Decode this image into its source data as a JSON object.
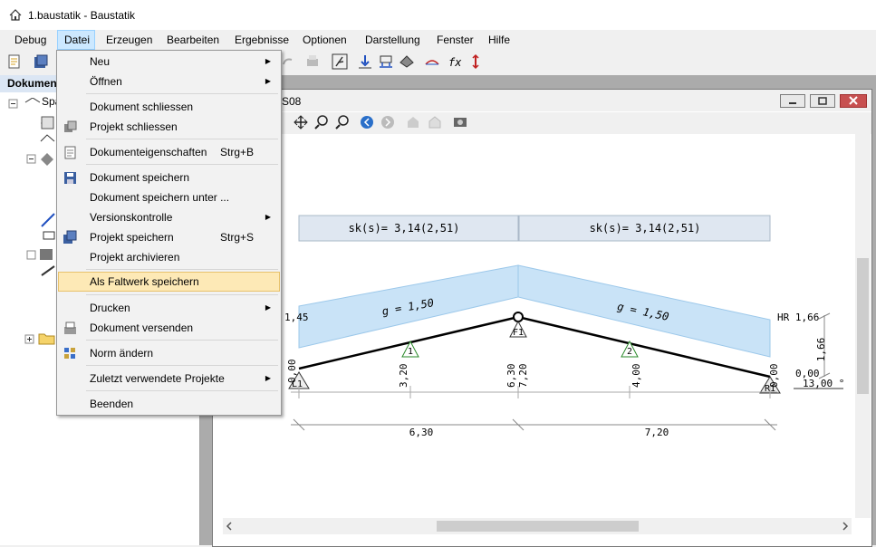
{
  "window": {
    "title": "1.baustatik - Baustatik"
  },
  "menubar": {
    "items": [
      "Debug",
      "Datei",
      "Erzeugen",
      "Bearbeiten",
      "Ergebnisse",
      "Optionen",
      "Darstellung",
      "Fenster",
      "Hilfe"
    ],
    "active": "Datei"
  },
  "left_panel": {
    "header": "Dokumen",
    "tree_root_label": "Spa"
  },
  "document_window": {
    "title_fragment": "S08"
  },
  "datei_menu": {
    "neu": "Neu",
    "oeffnen": "Öffnen",
    "dokument_schliessen": "Dokument schliessen",
    "projekt_schliessen": "Projekt schliessen",
    "dokumenteigenschaften": "Dokumenteigenschaften",
    "dokumenteigenschaften_shortcut": "Strg+B",
    "dokument_speichern": "Dokument speichern",
    "dokument_speichern_unter": "Dokument speichern unter ...",
    "versionskontrolle": "Versionskontrolle",
    "projekt_speichern": "Projekt speichern",
    "projekt_speichern_shortcut": "Strg+S",
    "projekt_archivieren": "Projekt archivieren",
    "als_faltwerk_speichern": "Als Faltwerk speichern",
    "drucken": "Drucken",
    "dokument_versenden": "Dokument versenden",
    "norm_aendern": "Norm ändern",
    "zuletzt_verwendete_projekte": "Zuletzt verwendete Projekte",
    "beenden": "Beenden"
  },
  "drawing": {
    "snow_left": "sk(s)= 3,14(2,51)",
    "snow_right": "sk(s)= 3,14(2,51)",
    "load_left": "g = 1,50",
    "load_right": "g = 1,50",
    "left_load_value": "1,45",
    "right_load_label": "HR 1,66",
    "right_dim_vertical": "1,66",
    "right_zero": "0,00",
    "angle_value": "13,00 °",
    "left_zero": "0,00",
    "node1": "1",
    "node2": "2",
    "node_f1": "F1",
    "node_l1": "L1",
    "node_r1": "R1",
    "coord_320": "3,20",
    "coord_630": "6,30",
    "coord_720": "7,20",
    "coord_400": "4,00",
    "coord_000_right": "0,00",
    "dim_left": "6,30",
    "dim_right": "7,20"
  },
  "colors": {
    "menu_highlight": "#fde9b6",
    "menubar_active": "#cce8ff",
    "load_fill": "#c9e3f7",
    "snow_fill": "#dfe7f1",
    "close_button": "#c75050"
  }
}
